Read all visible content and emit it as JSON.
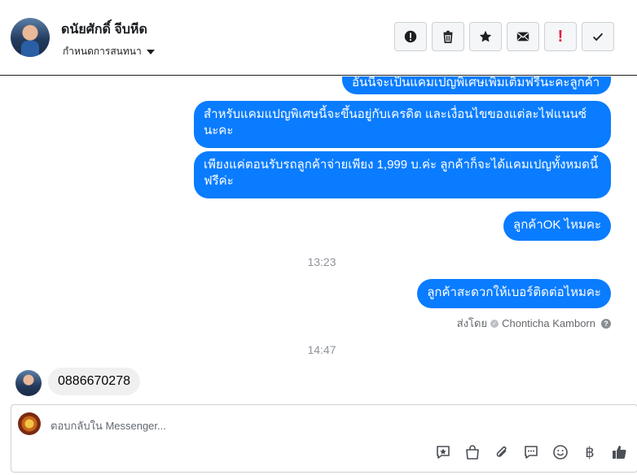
{
  "header": {
    "contact_name": "ดนัยศักดิ์ จีบหีด",
    "assign_label": "กำหนดการสนทนา",
    "actions": [
      {
        "name": "mark-spam-button",
        "icon": "alert-circle-icon"
      },
      {
        "name": "delete-button",
        "icon": "trash-icon"
      },
      {
        "name": "star-button",
        "icon": "star-icon"
      },
      {
        "name": "mark-unread-button",
        "icon": "envelope-icon"
      },
      {
        "name": "follow-up-button",
        "icon": "exclamation-icon",
        "glyph": "!"
      },
      {
        "name": "mark-done-button",
        "icon": "check-icon"
      }
    ]
  },
  "messages": {
    "m0": "อันนี้จะเป็นแคมเปญพิเศษเพิ่มเติมฟรีนะคะลูกค้า",
    "m1": "สำหรับแคมแปญพิเศษนี้จะขึ้นอยู่กับเครดิต และเงื่อนไขของแต่ละไฟแนนซ์นะคะ",
    "m2": "เพียงแค่ตอนรับรถลูกค้าจ่ายเพียง 1,999 บ.ค่ะ ลูกค้าก็จะได้แคมเปญทั้งหมดนี้ฟรีค่ะ",
    "m3": "ลูกค้าOK ไหมคะ",
    "time1": "13:23",
    "m4": "ลูกค้าสะดวกให้เบอร์ติดต่อไหมคะ",
    "sent_by_label": "ส่งโดย",
    "sender": "Chonticha Kamborn",
    "time2": "14:47",
    "incoming": "0886670278"
  },
  "composer": {
    "placeholder": "ตอบกลับใน Messenger...",
    "tools": [
      "saved-reply-icon",
      "shop-bag-icon",
      "paperclip-icon",
      "speech-bubble-icon",
      "emoji-icon",
      "baht-icon",
      "thumbs-up-icon"
    ],
    "baht_glyph": "฿"
  },
  "colors": {
    "outgoing_bubble": "#0a7cff",
    "incoming_bubble": "#f0f0f0",
    "follow_up_red": "#e41e3f"
  }
}
